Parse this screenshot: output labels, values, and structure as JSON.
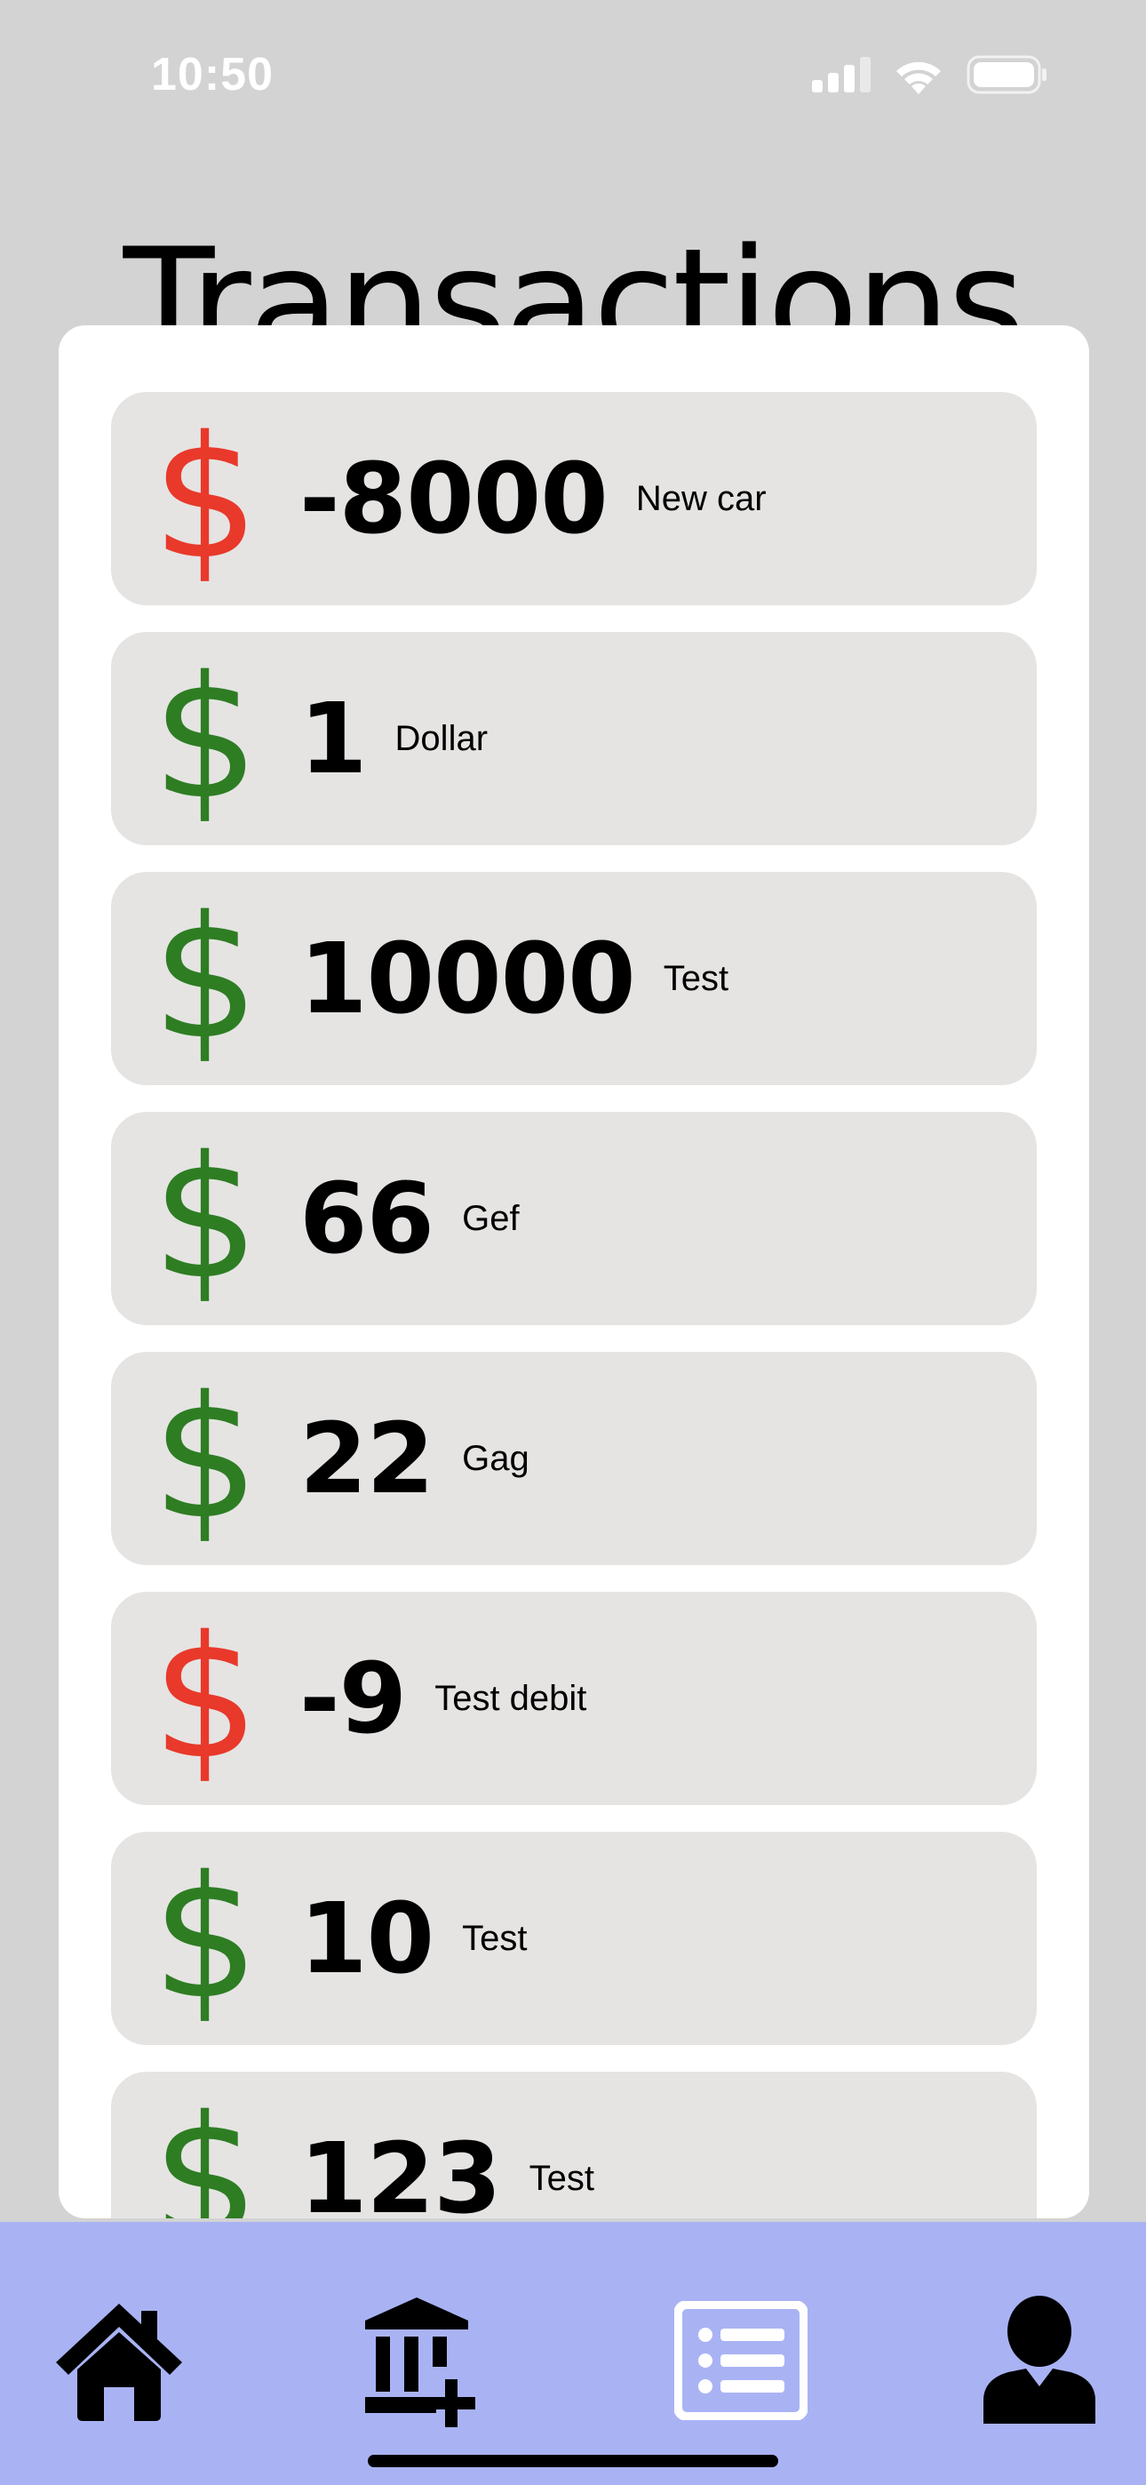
{
  "status_bar": {
    "time": "10:50"
  },
  "header": {
    "title": "Transactions"
  },
  "transactions": [
    {
      "amount": "-8000",
      "description": "New car",
      "color": "#e8392b"
    },
    {
      "amount": "1",
      "description": "Dollar",
      "color": "#2e7d23"
    },
    {
      "amount": "10000",
      "description": "Test",
      "color": "#2e7d23"
    },
    {
      "amount": "66",
      "description": "Gef",
      "color": "#2e7d23"
    },
    {
      "amount": "22",
      "description": "Gag",
      "color": "#2e7d23"
    },
    {
      "amount": "-9",
      "description": "Test debit",
      "color": "#e8392b"
    },
    {
      "amount": "10",
      "description": "Test",
      "color": "#2e7d23"
    },
    {
      "amount": "123",
      "description": "Test",
      "color": "#2e7d23"
    }
  ],
  "icon_glyph": "$",
  "colors": {
    "credit": "#2e7d23",
    "debit": "#e8392b",
    "nav_bar": "#a9b3f4",
    "background": "#d3d3d3"
  },
  "nav": [
    {
      "icon": "home-icon"
    },
    {
      "icon": "add-bank-icon"
    },
    {
      "icon": "list-icon"
    },
    {
      "icon": "profile-icon"
    }
  ]
}
